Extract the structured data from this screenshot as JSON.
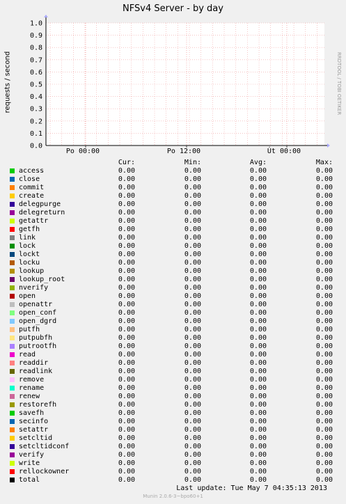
{
  "chart_data": {
    "type": "line",
    "title": "NFSv4 Server - by day",
    "ylabel": "requests / second",
    "ylim": [
      0,
      1.0
    ],
    "yticks": [
      "0.0",
      "0.1",
      "0.2",
      "0.3",
      "0.4",
      "0.5",
      "0.6",
      "0.7",
      "0.8",
      "0.9",
      "1.0"
    ],
    "xticks": [
      "Po 00:00",
      "Po 12:00",
      "Út 00:00"
    ],
    "grid": true,
    "series_note": "all series flat at 0.00",
    "legend_columns": [
      "Cur:",
      "Min:",
      "Avg:",
      "Max:"
    ],
    "series": [
      {
        "name": "access",
        "color": "#00cc00",
        "cur": "0.00",
        "min": "0.00",
        "avg": "0.00",
        "max": "0.00"
      },
      {
        "name": "close",
        "color": "#0066b3",
        "cur": "0.00",
        "min": "0.00",
        "avg": "0.00",
        "max": "0.00"
      },
      {
        "name": "commit",
        "color": "#ff8000",
        "cur": "0.00",
        "min": "0.00",
        "avg": "0.00",
        "max": "0.00"
      },
      {
        "name": "create",
        "color": "#ffcc00",
        "cur": "0.00",
        "min": "0.00",
        "avg": "0.00",
        "max": "0.00"
      },
      {
        "name": "delegpurge",
        "color": "#330099",
        "cur": "0.00",
        "min": "0.00",
        "avg": "0.00",
        "max": "0.00"
      },
      {
        "name": "delegreturn",
        "color": "#990099",
        "cur": "0.00",
        "min": "0.00",
        "avg": "0.00",
        "max": "0.00"
      },
      {
        "name": "getattr",
        "color": "#ccff00",
        "cur": "0.00",
        "min": "0.00",
        "avg": "0.00",
        "max": "0.00"
      },
      {
        "name": "getfh",
        "color": "#ff0000",
        "cur": "0.00",
        "min": "0.00",
        "avg": "0.00",
        "max": "0.00"
      },
      {
        "name": "link",
        "color": "#808080",
        "cur": "0.00",
        "min": "0.00",
        "avg": "0.00",
        "max": "0.00"
      },
      {
        "name": "lock",
        "color": "#008f00",
        "cur": "0.00",
        "min": "0.00",
        "avg": "0.00",
        "max": "0.00"
      },
      {
        "name": "lockt",
        "color": "#00487d",
        "cur": "0.00",
        "min": "0.00",
        "avg": "0.00",
        "max": "0.00"
      },
      {
        "name": "locku",
        "color": "#b35a00",
        "cur": "0.00",
        "min": "0.00",
        "avg": "0.00",
        "max": "0.00"
      },
      {
        "name": "lookup",
        "color": "#b38f00",
        "cur": "0.00",
        "min": "0.00",
        "avg": "0.00",
        "max": "0.00"
      },
      {
        "name": "lookup_root",
        "color": "#6b006b",
        "cur": "0.00",
        "min": "0.00",
        "avg": "0.00",
        "max": "0.00"
      },
      {
        "name": "nverify",
        "color": "#8fb300",
        "cur": "0.00",
        "min": "0.00",
        "avg": "0.00",
        "max": "0.00"
      },
      {
        "name": "open",
        "color": "#b30000",
        "cur": "0.00",
        "min": "0.00",
        "avg": "0.00",
        "max": "0.00"
      },
      {
        "name": "openattr",
        "color": "#bebebe",
        "cur": "0.00",
        "min": "0.00",
        "avg": "0.00",
        "max": "0.00"
      },
      {
        "name": "open_conf",
        "color": "#80ff80",
        "cur": "0.00",
        "min": "0.00",
        "avg": "0.00",
        "max": "0.00"
      },
      {
        "name": "open_dgrd",
        "color": "#80c9ff",
        "cur": "0.00",
        "min": "0.00",
        "avg": "0.00",
        "max": "0.00"
      },
      {
        "name": "putfh",
        "color": "#ffc080",
        "cur": "0.00",
        "min": "0.00",
        "avg": "0.00",
        "max": "0.00"
      },
      {
        "name": "putpubfh",
        "color": "#ffe680",
        "cur": "0.00",
        "min": "0.00",
        "avg": "0.00",
        "max": "0.00"
      },
      {
        "name": "putrootfh",
        "color": "#aa80ff",
        "cur": "0.00",
        "min": "0.00",
        "avg": "0.00",
        "max": "0.00"
      },
      {
        "name": "read",
        "color": "#ee00cc",
        "cur": "0.00",
        "min": "0.00",
        "avg": "0.00",
        "max": "0.00"
      },
      {
        "name": "readdir",
        "color": "#ff8080",
        "cur": "0.00",
        "min": "0.00",
        "avg": "0.00",
        "max": "0.00"
      },
      {
        "name": "readlink",
        "color": "#666600",
        "cur": "0.00",
        "min": "0.00",
        "avg": "0.00",
        "max": "0.00"
      },
      {
        "name": "remove",
        "color": "#ffbfff",
        "cur": "0.00",
        "min": "0.00",
        "avg": "0.00",
        "max": "0.00"
      },
      {
        "name": "rename",
        "color": "#00ffcc",
        "cur": "0.00",
        "min": "0.00",
        "avg": "0.00",
        "max": "0.00"
      },
      {
        "name": "renew",
        "color": "#cc6699",
        "cur": "0.00",
        "min": "0.00",
        "avg": "0.00",
        "max": "0.00"
      },
      {
        "name": "restorefh",
        "color": "#999900",
        "cur": "0.00",
        "min": "0.00",
        "avg": "0.00",
        "max": "0.00"
      },
      {
        "name": "savefh",
        "color": "#00cc00",
        "cur": "0.00",
        "min": "0.00",
        "avg": "0.00",
        "max": "0.00"
      },
      {
        "name": "secinfo",
        "color": "#0066b3",
        "cur": "0.00",
        "min": "0.00",
        "avg": "0.00",
        "max": "0.00"
      },
      {
        "name": "setattr",
        "color": "#ff8000",
        "cur": "0.00",
        "min": "0.00",
        "avg": "0.00",
        "max": "0.00"
      },
      {
        "name": "setcltid",
        "color": "#ffcc00",
        "cur": "0.00",
        "min": "0.00",
        "avg": "0.00",
        "max": "0.00"
      },
      {
        "name": "setcltidconf",
        "color": "#330099",
        "cur": "0.00",
        "min": "0.00",
        "avg": "0.00",
        "max": "0.00"
      },
      {
        "name": "verify",
        "color": "#990099",
        "cur": "0.00",
        "min": "0.00",
        "avg": "0.00",
        "max": "0.00"
      },
      {
        "name": "write",
        "color": "#ccff00",
        "cur": "0.00",
        "min": "0.00",
        "avg": "0.00",
        "max": "0.00"
      },
      {
        "name": "rellockowner",
        "color": "#ff0000",
        "cur": "0.00",
        "min": "0.00",
        "avg": "0.00",
        "max": "0.00"
      },
      {
        "name": "total",
        "color": "#000000",
        "cur": "0.00",
        "min": "0.00",
        "avg": "0.00",
        "max": "0.00"
      }
    ]
  },
  "side_label": "RRDTOOL / TOBI OETIKER",
  "footer": {
    "last_update": "Last update:  Tue May  7 04:35:13 2013",
    "version": "Munin 2.0.6-3~bpo60+1"
  }
}
